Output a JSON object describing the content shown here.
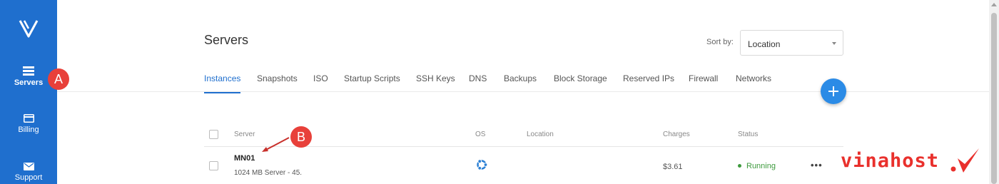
{
  "sidebar": {
    "items": [
      {
        "label": "Servers",
        "icon": "servers-icon",
        "active": true
      },
      {
        "label": "Billing",
        "icon": "billing-icon"
      },
      {
        "label": "Support",
        "icon": "support-icon"
      }
    ]
  },
  "header": {
    "title": "Servers",
    "sort_label": "Sort by:",
    "sort_value": "Location"
  },
  "tabs": [
    "Instances",
    "Snapshots",
    "ISO",
    "Startup Scripts",
    "SSH Keys",
    "DNS",
    "Backups",
    "Block Storage",
    "Reserved IPs",
    "Firewall",
    "Networks"
  ],
  "table": {
    "columns": [
      "Server",
      "OS",
      "Location",
      "Charges",
      "Status"
    ],
    "rows": [
      {
        "name": "MN01",
        "description": "1024 MB Server - 45.",
        "os": "ubuntu-icon",
        "location": "",
        "charges": "$3.61",
        "status": "Running"
      }
    ]
  },
  "annotations": {
    "a": "A",
    "b": "B"
  },
  "watermark": {
    "text": "vinahost"
  },
  "colors": {
    "sidebar": "#1f6fce",
    "accent": "#2b8be6",
    "badge": "#e8403a",
    "running": "#3d9a3d"
  }
}
